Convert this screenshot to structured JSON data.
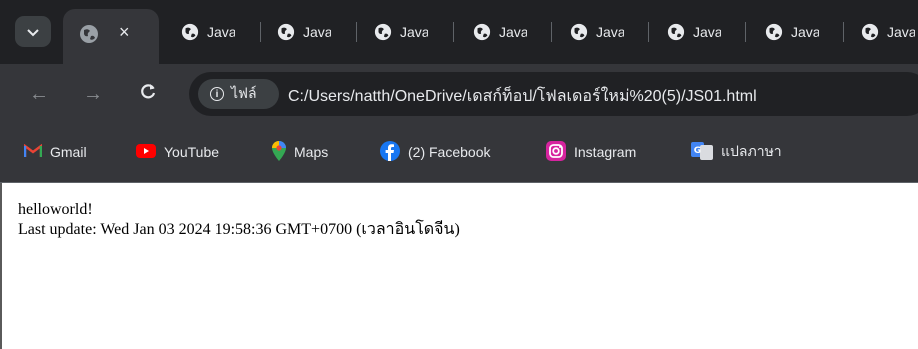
{
  "tabstrip": {
    "menu_icon": "chevron-down-icon",
    "active_tab": {
      "icon": "globe-icon",
      "close_icon": "close-icon",
      "close_glyph": "×"
    },
    "tabs": [
      {
        "label": "Java",
        "icon": "globe-icon"
      },
      {
        "label": "Java",
        "icon": "globe-icon"
      },
      {
        "label": "Java",
        "icon": "globe-icon"
      },
      {
        "label": "Java",
        "icon": "globe-icon"
      },
      {
        "label": "Java",
        "icon": "globe-icon"
      },
      {
        "label": "Java",
        "icon": "globe-icon"
      },
      {
        "label": "Java",
        "icon": "globe-icon"
      },
      {
        "label": "Java",
        "icon": "globe-icon"
      }
    ]
  },
  "toolbar": {
    "back_glyph": "←",
    "forward_glyph": "→",
    "reload_glyph": "C",
    "site_chip_label": "ไฟล์",
    "url": "C:/Users/natth/OneDrive/เดสก์ท็อป/โฟลเดอร์ใหม่%20(5)/JS01.html"
  },
  "bookmarks": [
    {
      "label": "Gmail",
      "icon": "gmail-icon"
    },
    {
      "label": "YouTube",
      "icon": "youtube-icon"
    },
    {
      "label": "Maps",
      "icon": "maps-icon"
    },
    {
      "label": "(2) Facebook",
      "icon": "facebook-icon"
    },
    {
      "label": "Instagram",
      "icon": "instagram-icon"
    },
    {
      "label": "แปลภาษา",
      "icon": "translate-icon"
    }
  ],
  "page": {
    "line1": "helloworld!",
    "line2": "Last update: Wed Jan 03 2024 19:58:36 GMT+0700 (เวลาอินโดจีน)"
  },
  "colors": {
    "tabstrip_bg": "#202124",
    "toolbar_bg": "#35363a",
    "text_light": "#e8eaed"
  }
}
